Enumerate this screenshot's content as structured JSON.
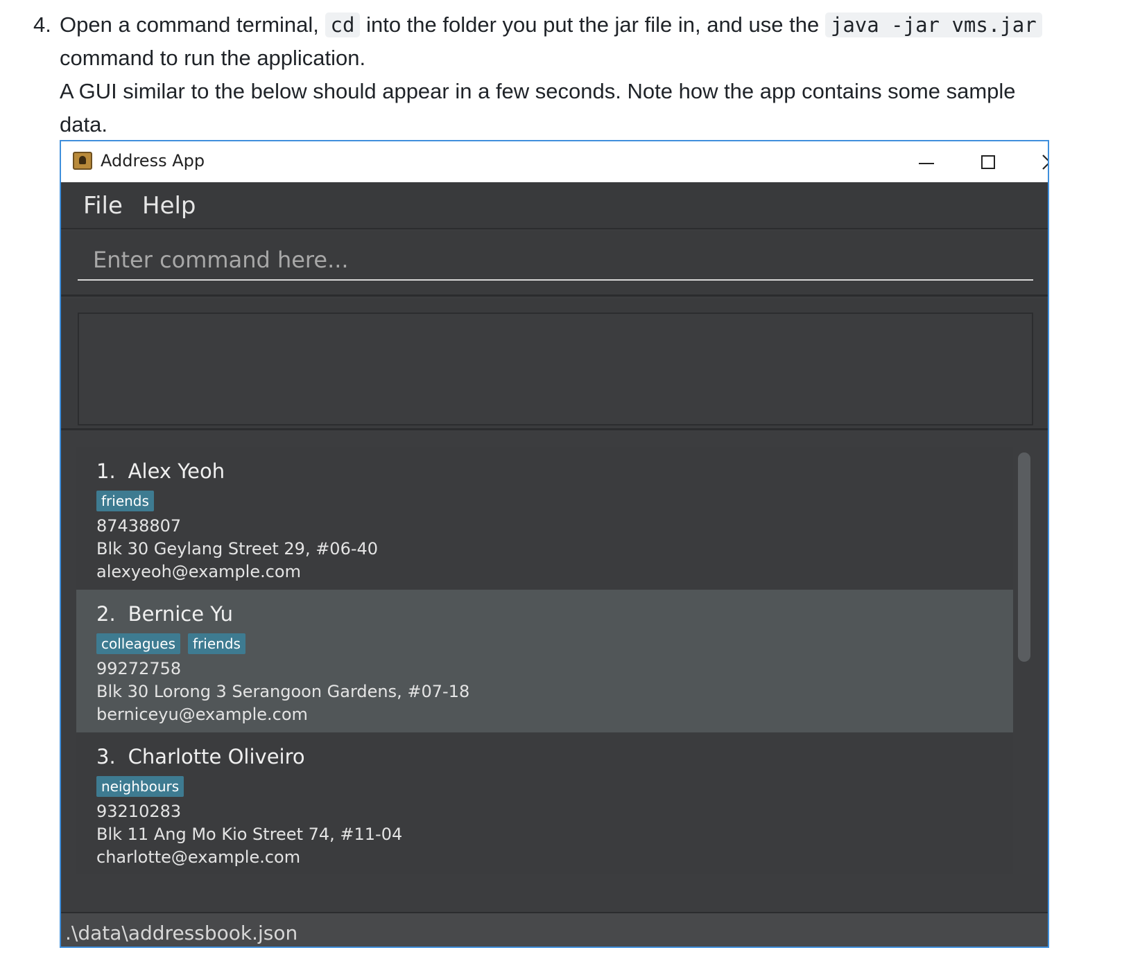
{
  "instruction": {
    "number": "4.",
    "part1": "Open a command terminal,",
    "code1": "cd",
    "part2": "into the folder you put the jar file in, and use the",
    "code2": "java -jar vms.jar",
    "part3": "command to run the application.",
    "part4": "A GUI similar to the below should appear in a few seconds. Note how the app contains some sample data."
  },
  "window": {
    "title": "Address App",
    "icon": "address-book-icon",
    "controls": {
      "minimize": "minimize-icon",
      "maximize": "maximize-icon",
      "close": "close-icon",
      "close_glyph": "✕"
    }
  },
  "menu": {
    "file": "File",
    "help": "Help"
  },
  "command": {
    "placeholder": "Enter command here...",
    "value": ""
  },
  "result": {
    "text": ""
  },
  "persons": [
    {
      "index": "1.",
      "name": "Alex Yeoh",
      "tags": [
        "friends"
      ],
      "phone": "87438807",
      "address": "Blk 30 Geylang Street 29, #06-40",
      "email": "alexyeoh@example.com"
    },
    {
      "index": "2.",
      "name": "Bernice Yu",
      "tags": [
        "colleagues",
        "friends"
      ],
      "phone": "99272758",
      "address": "Blk 30 Lorong 3 Serangoon Gardens, #07-18",
      "email": "berniceyu@example.com"
    },
    {
      "index": "3.",
      "name": "Charlotte Oliveiro",
      "tags": [
        "neighbours"
      ],
      "phone": "93210283",
      "address": "Blk 11 Ang Mo Kio Street 74, #11-04",
      "email": "charlotte@example.com"
    }
  ],
  "status": {
    "path": ".\\data\\addressbook.json"
  },
  "colors": {
    "window_border": "#3f8fdc",
    "tag_bg": "#3e7b91",
    "panel_bg": "#3c3d3f",
    "selected_card_bg": "#515658"
  }
}
